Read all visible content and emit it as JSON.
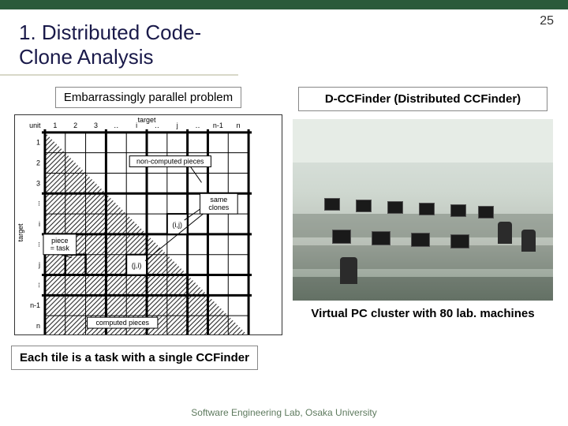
{
  "slide_number": "25",
  "title": "1. Distributed Code-Clone Analysis",
  "left": {
    "header": "Embarrassingly parallel problem",
    "caption": "Each tile is a task with a single CCFinder",
    "diagram": {
      "axis_x_label": "target",
      "axis_y_label": "target",
      "unit_label": "unit",
      "col_headers": [
        "1",
        "2",
        "3",
        "‥",
        "i",
        "‥",
        "j",
        "‥",
        "n-1",
        "n"
      ],
      "row_headers": [
        "1",
        "2",
        "3",
        "⁝",
        "i",
        "⁝",
        "j",
        "⁝",
        "n-1",
        "n"
      ],
      "labels": {
        "non_computed": "non-computed pieces",
        "same_clones": "same\nclones",
        "cell_ji": "(j,i)",
        "cell_ij": "(i,j)",
        "piece_task": "piece\n= task",
        "computed": "computed pieces"
      }
    }
  },
  "right": {
    "header": "D-CCFinder (Distributed CCFinder)",
    "caption": "Virtual PC cluster with 80 lab. machines"
  },
  "footer": "Software Engineering Lab, Osaka University"
}
